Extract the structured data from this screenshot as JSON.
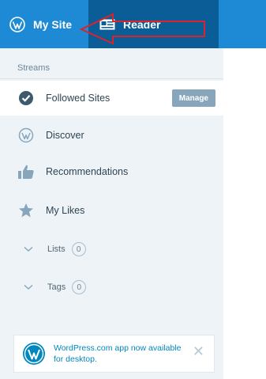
{
  "masterbar": {
    "my_site_label": "My Site",
    "reader_label": "Reader"
  },
  "sidebar": {
    "section_title": "Streams",
    "items": [
      {
        "label": "Followed Sites",
        "icon": "checkmark-circle-icon",
        "active": true,
        "action_label": "Manage"
      },
      {
        "label": "Discover",
        "icon": "wordpress-icon",
        "active": false
      },
      {
        "label": "Recommendations",
        "icon": "thumbs-up-icon",
        "active": false
      },
      {
        "label": "My Likes",
        "icon": "star-icon",
        "active": false
      }
    ],
    "collapsibles": [
      {
        "label": "Lists",
        "count": "0",
        "icon": "chevron-down-icon"
      },
      {
        "label": "Tags",
        "count": "0",
        "icon": "chevron-down-icon"
      }
    ]
  },
  "notice": {
    "text": "WordPress.com app now available for desktop.",
    "icon": "wordpress-icon",
    "close_icon": "close-icon"
  },
  "colors": {
    "masterbar": "#1e8ad6",
    "masterbar_active": "#0b5d97",
    "sidebar_bg": "#eef3f7",
    "manage_button": "#87a6bc",
    "notice_text": "#0087be",
    "annotation": "#d9242b"
  }
}
